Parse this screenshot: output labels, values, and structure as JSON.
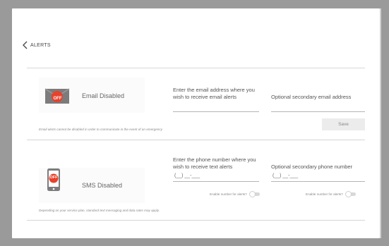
{
  "header": {
    "back_label": "ALERTS"
  },
  "email": {
    "status": "Email Disabled",
    "badge": "OFF",
    "primary_label": "Enter the email address where you wish to receive email alerts",
    "secondary_label": "Optional secondary email address",
    "note": "Email alerts cannot be disabled in order to communicate in the event of an emergency",
    "save_label": "Save"
  },
  "sms": {
    "status": "SMS Disabled",
    "badge": "OFF",
    "primary_label": "Enter the phone number where you wish to receive text alerts",
    "secondary_label": "Optional secondary phone number",
    "primary_value": "(__) __-___",
    "secondary_value": "(__) __-___",
    "primary_toggle_label": "Enable number for alerts?",
    "secondary_toggle_label": "Enable number for alerts?",
    "note": "Depending on your service plan, standard text messaging and data rates may apply."
  },
  "colors": {
    "badge_red": "#e8412c",
    "icon_gray": "#7c7c7c",
    "background": "#9a9a9a"
  },
  "icons": {
    "back": "chevron-left-icon",
    "email": "envelope-icon",
    "sms": "phone-icon"
  }
}
